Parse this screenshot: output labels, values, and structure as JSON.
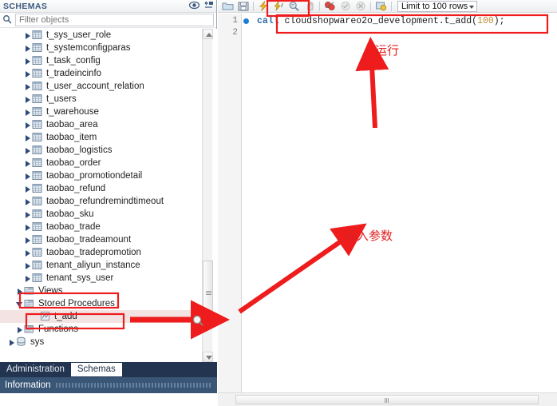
{
  "schemas_panel": {
    "title": "SCHEMAS",
    "header_icons": [
      "eye-icon",
      "collapse-all-icon"
    ],
    "filter": {
      "placeholder": "Filter objects",
      "value": ""
    },
    "tree": [
      {
        "label": "t_sys_user_role",
        "icon": "table-icon",
        "indent": 3,
        "state": "closed"
      },
      {
        "label": "t_systemconfigparas",
        "icon": "table-icon",
        "indent": 3,
        "state": "closed"
      },
      {
        "label": "t_task_config",
        "icon": "table-icon",
        "indent": 3,
        "state": "closed"
      },
      {
        "label": "t_tradeincinfo",
        "icon": "table-icon",
        "indent": 3,
        "state": "closed"
      },
      {
        "label": "t_user_account_relation",
        "icon": "table-icon",
        "indent": 3,
        "state": "closed"
      },
      {
        "label": "t_users",
        "icon": "table-icon",
        "indent": 3,
        "state": "closed"
      },
      {
        "label": "t_warehouse",
        "icon": "table-icon",
        "indent": 3,
        "state": "closed"
      },
      {
        "label": "taobao_area",
        "icon": "table-icon",
        "indent": 3,
        "state": "closed"
      },
      {
        "label": "taobao_item",
        "icon": "table-icon",
        "indent": 3,
        "state": "closed"
      },
      {
        "label": "taobao_logistics",
        "icon": "table-icon",
        "indent": 3,
        "state": "closed"
      },
      {
        "label": "taobao_order",
        "icon": "table-icon",
        "indent": 3,
        "state": "closed"
      },
      {
        "label": "taobao_promotiondetail",
        "icon": "table-icon",
        "indent": 3,
        "state": "closed"
      },
      {
        "label": "taobao_refund",
        "icon": "table-icon",
        "indent": 3,
        "state": "closed"
      },
      {
        "label": "taobao_refundremindtimeout",
        "icon": "table-icon",
        "indent": 3,
        "state": "closed"
      },
      {
        "label": "taobao_sku",
        "icon": "table-icon",
        "indent": 3,
        "state": "closed"
      },
      {
        "label": "taobao_trade",
        "icon": "table-icon",
        "indent": 3,
        "state": "closed"
      },
      {
        "label": "taobao_tradeamount",
        "icon": "table-icon",
        "indent": 3,
        "state": "closed"
      },
      {
        "label": "taobao_tradepromotion",
        "icon": "table-icon",
        "indent": 3,
        "state": "closed"
      },
      {
        "label": "tenant_aliyun_instance",
        "icon": "table-icon",
        "indent": 3,
        "state": "closed"
      },
      {
        "label": "tenant_sys_user",
        "icon": "table-icon",
        "indent": 3,
        "state": "closed"
      },
      {
        "label": "Views",
        "icon": "views-folder-icon",
        "indent": 2,
        "state": "closed"
      },
      {
        "label": "Stored Procedures",
        "icon": "procedures-folder-icon",
        "indent": 2,
        "state": "open"
      },
      {
        "label": "t_add",
        "icon": "procedure-icon",
        "indent": 4,
        "state": "leaf",
        "selected": true
      },
      {
        "label": "Functions",
        "icon": "functions-folder-icon",
        "indent": 2,
        "state": "closed"
      },
      {
        "label": "sys",
        "icon": "schema-icon",
        "indent": 1,
        "state": "closed"
      }
    ],
    "tabs": [
      {
        "label": "Administration",
        "active": false
      },
      {
        "label": "Schemas",
        "active": true
      }
    ],
    "status": {
      "label": "Information"
    }
  },
  "editor_panel": {
    "toolbar": {
      "buttons": [
        {
          "name": "open-sql-file-icon",
          "title": "Open a SQL script file"
        },
        {
          "name": "save-script-icon",
          "title": "Save script to file"
        },
        {
          "name": "execute-statement-icon",
          "title": "Execute the selected portion or everything"
        },
        {
          "name": "execute-current-icon",
          "title": "Execute the statement under the keyboard cursor"
        },
        {
          "name": "explain-query-icon",
          "title": "Explain the statement under the keyboard cursor"
        },
        {
          "name": "stop-query-icon",
          "title": "Stop the query being executed"
        },
        {
          "name": "toggle-commit-icon",
          "title": "Toggle whether execution is committed"
        },
        {
          "name": "commit-icon",
          "title": "Commit"
        },
        {
          "name": "rollback-icon",
          "title": "Rollback"
        },
        {
          "name": "query-options-icon",
          "title": "Query options"
        }
      ],
      "limit_combo": {
        "label": "Limit to 100 rows",
        "value": "Limit to 100 rows"
      }
    },
    "lines": [
      {
        "number": "1",
        "breakpoint": true,
        "tokens": [
          {
            "text": "call ",
            "type": "kw"
          },
          {
            "text": "cloudshopwareo2o_development.t_add",
            "type": "id"
          },
          {
            "text": "(",
            "type": "pun"
          },
          {
            "text": "100",
            "type": "num"
          },
          {
            "text": ");",
            "type": "pun"
          }
        ]
      },
      {
        "number": "2",
        "breakpoint": false,
        "tokens": []
      }
    ]
  },
  "annotations": {
    "accent_color": "#ee1c1c",
    "run_label": "运行",
    "param_label": "输入参数",
    "boxes": [
      {
        "name": "execute-toolbar-highlight"
      },
      {
        "name": "sql-statement-highlight"
      },
      {
        "name": "stored-procedures-highlight"
      },
      {
        "name": "t-add-procedure-highlight"
      }
    ],
    "arrows": [
      {
        "name": "run-arrow"
      },
      {
        "name": "param-arrow"
      },
      {
        "name": "procedure-arrow"
      }
    ]
  }
}
